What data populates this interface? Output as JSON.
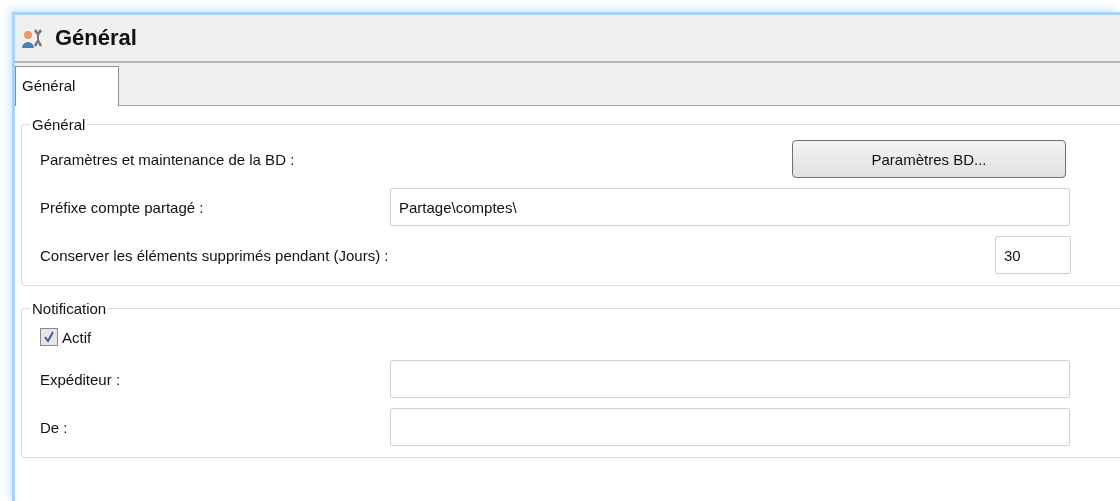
{
  "window": {
    "title": "Général"
  },
  "tabs": [
    {
      "label": "Général",
      "selected": true
    }
  ],
  "groups": [
    {
      "title": "Général",
      "rows": [
        {
          "kind": "button",
          "label": "Paramètres et maintenance de la BD :",
          "button": "Paramètres BD..."
        },
        {
          "kind": "field",
          "label": "Préfixe compte partagé :",
          "value": "Partage\\comptes\\"
        },
        {
          "kind": "short-field",
          "label": "Conserver les éléments supprimés pendant (Jours) :",
          "value": "30"
        }
      ]
    },
    {
      "title": "Notification",
      "rows": [
        {
          "kind": "checkbox",
          "label": "Actif",
          "checked": true
        },
        {
          "kind": "field",
          "label": "Expéditeur :",
          "value": ""
        },
        {
          "kind": "field",
          "label": "De :",
          "value": ""
        }
      ]
    }
  ]
}
